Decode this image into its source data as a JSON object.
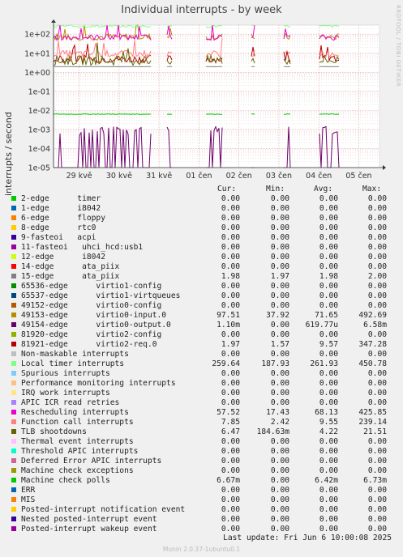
{
  "title": "Individual interrupts - by week",
  "side_text": "RRDTOOL / TOBI OETIKER",
  "footer": "Munin 2.0.37-1ubuntu0.1",
  "last_update": "Last update: Fri Jun  6 10:00:08 2025",
  "chart_data": {
    "type": "line",
    "ylabel": "interrupts / second",
    "yscale": "log",
    "ylim": [
      1e-05,
      300
    ],
    "y_ticks": [
      "1e-05",
      "1e-04",
      "1e-03",
      "1e-02",
      "1e-01",
      "1e+00",
      "1e+01",
      "1e+02"
    ],
    "x_ticks": [
      "29 kvě",
      "30 kvě",
      "31 kvě",
      "01 čen",
      "02 čen",
      "03 čen",
      "04 čen",
      "05 čen"
    ],
    "columns": [
      "Cur:",
      "Min:",
      "Avg:",
      "Max:"
    ],
    "series": [
      {
        "name": "2-edge      timer",
        "color": "#00cc00",
        "cur": "0.00",
        "min": "0.00",
        "avg": "0.00",
        "max": "0.00"
      },
      {
        "name": "1-edge      i8042",
        "color": "#0066b3",
        "cur": "0.00",
        "min": "0.00",
        "avg": "0.00",
        "max": "0.00"
      },
      {
        "name": "6-edge      floppy",
        "color": "#ff8000",
        "cur": "0.00",
        "min": "0.00",
        "avg": "0.00",
        "max": "0.00"
      },
      {
        "name": "8-edge      rtc0",
        "color": "#ffcc00",
        "cur": "0.00",
        "min": "0.00",
        "avg": "0.00",
        "max": "0.00"
      },
      {
        "name": "9-fasteoi   acpi",
        "color": "#330099",
        "cur": "0.00",
        "min": "0.00",
        "avg": "0.00",
        "max": "0.00"
      },
      {
        "name": "11-fasteoi   uhci_hcd:usb1",
        "color": "#990099",
        "cur": "0.00",
        "min": "0.00",
        "avg": "0.00",
        "max": "0.00"
      },
      {
        "name": "12-edge      i8042",
        "color": "#ccff00",
        "cur": "0.00",
        "min": "0.00",
        "avg": "0.00",
        "max": "0.00"
      },
      {
        "name": "14-edge      ata_piix",
        "color": "#ff0000",
        "cur": "0.00",
        "min": "0.00",
        "avg": "0.00",
        "max": "0.00"
      },
      {
        "name": "15-edge      ata_piix",
        "color": "#808080",
        "cur": "1.98",
        "min": "1.97",
        "avg": "1.98",
        "max": "2.00"
      },
      {
        "name": "65536-edge      virtio1-config",
        "color": "#008f00",
        "cur": "0.00",
        "min": "0.00",
        "avg": "0.00",
        "max": "0.00"
      },
      {
        "name": "65537-edge      virtio1-virtqueues",
        "color": "#00487d",
        "cur": "0.00",
        "min": "0.00",
        "avg": "0.00",
        "max": "0.00"
      },
      {
        "name": "49152-edge      virtio0-config",
        "color": "#b35a00",
        "cur": "0.00",
        "min": "0.00",
        "avg": "0.00",
        "max": "0.00"
      },
      {
        "name": "49153-edge      virtio0-input.0",
        "color": "#b38f00",
        "cur": "97.51",
        "min": "37.92",
        "avg": "71.65",
        "max": "492.69"
      },
      {
        "name": "49154-edge      virtio0-output.0",
        "color": "#6b006b",
        "cur": "1.10m",
        "min": "0.00",
        "avg": "619.77u",
        "max": "6.58m"
      },
      {
        "name": "81920-edge      virtio2-config",
        "color": "#8fb300",
        "cur": "0.00",
        "min": "0.00",
        "avg": "0.00",
        "max": "0.00"
      },
      {
        "name": "81921-edge      virtio2-req.0",
        "color": "#b30000",
        "cur": "1.97",
        "min": "1.57",
        "avg": "9.57",
        "max": "347.28"
      },
      {
        "name": "Non-maskable interrupts",
        "color": "#bebebe",
        "cur": "0.00",
        "min": "0.00",
        "avg": "0.00",
        "max": "0.00"
      },
      {
        "name": "Local timer interrupts",
        "color": "#80ff80",
        "cur": "259.64",
        "min": "187.93",
        "avg": "261.93",
        "max": "450.78"
      },
      {
        "name": "Spurious interrupts",
        "color": "#80c9ff",
        "cur": "0.00",
        "min": "0.00",
        "avg": "0.00",
        "max": "0.00"
      },
      {
        "name": "Performance monitoring interrupts",
        "color": "#ffc080",
        "cur": "0.00",
        "min": "0.00",
        "avg": "0.00",
        "max": "0.00"
      },
      {
        "name": "IRQ work interrupts",
        "color": "#ffe680",
        "cur": "0.00",
        "min": "0.00",
        "avg": "0.00",
        "max": "0.00"
      },
      {
        "name": "APIC ICR read retries",
        "color": "#aa80ff",
        "cur": "0.00",
        "min": "0.00",
        "avg": "0.00",
        "max": "0.00"
      },
      {
        "name": "Rescheduling interrupts",
        "color": "#ee00cc",
        "cur": "57.52",
        "min": "17.43",
        "avg": "68.13",
        "max": "425.85"
      },
      {
        "name": "Function call interrupts",
        "color": "#ff8080",
        "cur": "7.85",
        "min": "2.42",
        "avg": "9.55",
        "max": "239.14"
      },
      {
        "name": "TLB shootdowns",
        "color": "#666600",
        "cur": "6.47",
        "min": "184.63m",
        "avg": "4.22",
        "max": "21.51"
      },
      {
        "name": "Thermal event interrupts",
        "color": "#ffbfff",
        "cur": "0.00",
        "min": "0.00",
        "avg": "0.00",
        "max": "0.00"
      },
      {
        "name": "Threshold APIC interrupts",
        "color": "#00ffcc",
        "cur": "0.00",
        "min": "0.00",
        "avg": "0.00",
        "max": "0.00"
      },
      {
        "name": "Deferred Error APIC interrupts",
        "color": "#cc6699",
        "cur": "0.00",
        "min": "0.00",
        "avg": "0.00",
        "max": "0.00"
      },
      {
        "name": "Machine check exceptions",
        "color": "#999900",
        "cur": "0.00",
        "min": "0.00",
        "avg": "0.00",
        "max": "0.00"
      },
      {
        "name": "Machine check polls",
        "color": "#00cc00",
        "cur": "6.67m",
        "min": "0.00",
        "avg": "6.42m",
        "max": "6.73m"
      },
      {
        "name": "ERR",
        "color": "#0066b3",
        "cur": "0.00",
        "min": "0.00",
        "avg": "0.00",
        "max": "0.00"
      },
      {
        "name": "MIS",
        "color": "#ff8000",
        "cur": "0.00",
        "min": "0.00",
        "avg": "0.00",
        "max": "0.00"
      },
      {
        "name": "Posted-interrupt notification event",
        "color": "#ffcc00",
        "cur": "0.00",
        "min": "0.00",
        "avg": "0.00",
        "max": "0.00"
      },
      {
        "name": "Nested posted-interrupt event",
        "color": "#330099",
        "cur": "0.00",
        "min": "0.00",
        "avg": "0.00",
        "max": "0.00"
      },
      {
        "name": "Posted-interrupt wakeup event",
        "color": "#990099",
        "cur": "0.00",
        "min": "0.00",
        "avg": "0.00",
        "max": "0.00"
      }
    ]
  }
}
